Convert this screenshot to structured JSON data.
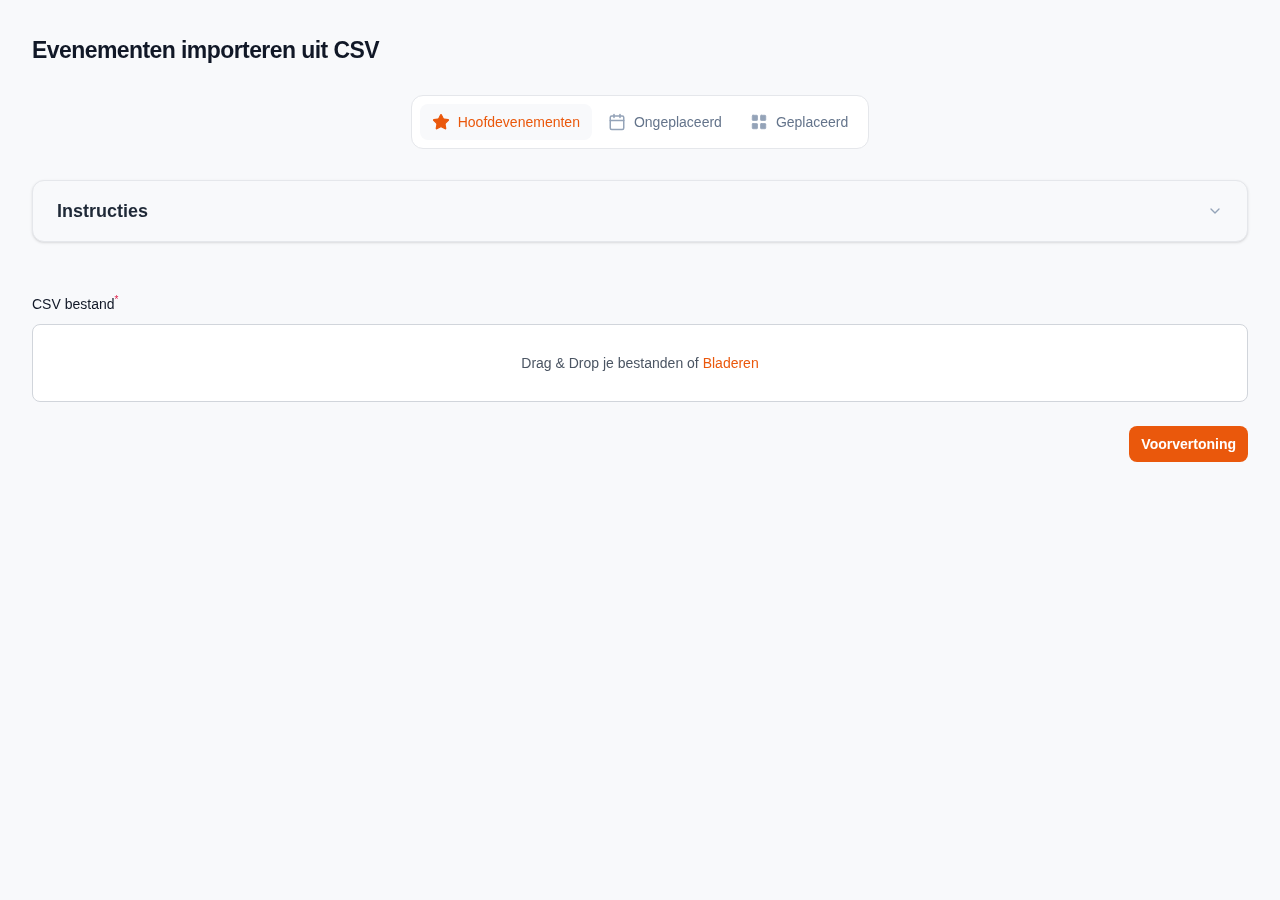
{
  "title": "Evenementen importeren uit CSV",
  "tabs": [
    {
      "label": "Hoofdevenementen",
      "kind": "star",
      "selected": true
    },
    {
      "label": "Ongeplaceerd",
      "kind": "calendar",
      "selected": false
    },
    {
      "label": "Geplaceerd",
      "kind": "grid",
      "selected": false
    }
  ],
  "accordion": {
    "title": "Instructies",
    "expanded": false
  },
  "file_field": {
    "label": "CSV bestand",
    "required_mark": "*",
    "prompt": "Drag & Drop je bestanden of",
    "link": "Bladeren"
  },
  "buttons": [
    "Voorvertoning"
  ]
}
